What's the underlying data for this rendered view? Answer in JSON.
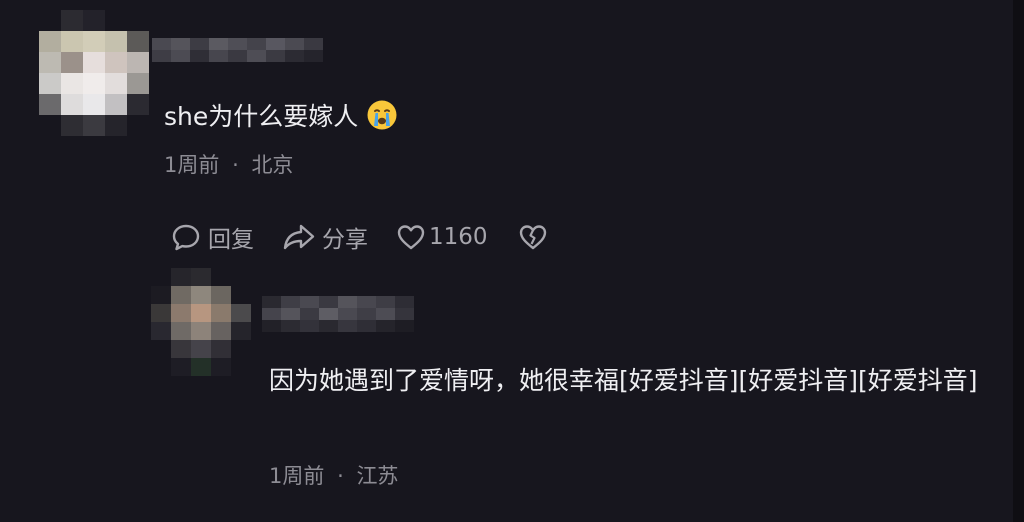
{
  "main_comment": {
    "text": "she为什么要嫁人",
    "emoji_icon": "crying-face-icon",
    "time": "1周前",
    "separator": "·",
    "location": "北京",
    "actions": {
      "reply_label": "回复",
      "share_label": "分享",
      "like_count": "1160",
      "reply_icon": "chat-bubble-icon",
      "share_icon": "share-arrow-icon",
      "like_icon": "heart-outline-icon",
      "dislike_icon": "broken-heart-icon"
    }
  },
  "reply_comment": {
    "text": "因为她遇到了爱情呀，她很幸福[好爱抖音][好爱抖音][好爱抖音]",
    "time": "1周前",
    "separator": "·",
    "location": "江苏"
  },
  "colors": {
    "background": "#17161e",
    "primary_text": "#efeff2",
    "secondary_text": "#8d8c94",
    "icon": "#a7a6ad"
  }
}
